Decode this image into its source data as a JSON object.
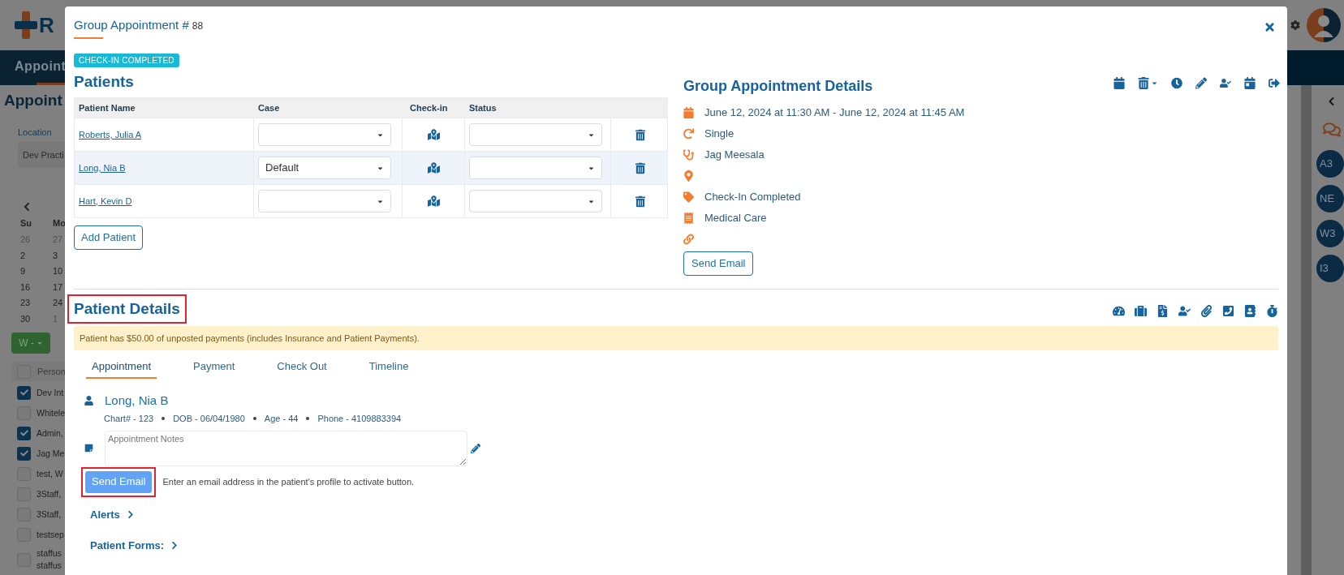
{
  "background": {
    "logo_text": "R",
    "nav_tab": "Appoint",
    "page_title": "Appoint",
    "location": {
      "label": "Location",
      "value": "Dev Practi"
    },
    "calendar": {
      "weekdays": [
        "Su",
        "Mo"
      ],
      "weeks": [
        [
          {
            "day": "26",
            "outside": true
          },
          {
            "day": "27",
            "outside": true
          }
        ],
        [
          {
            "day": "2",
            "outside": false
          },
          {
            "day": "3",
            "outside": false
          }
        ],
        [
          {
            "day": "9",
            "outside": false
          },
          {
            "day": "10",
            "outside": false
          }
        ],
        [
          {
            "day": "16",
            "outside": false
          },
          {
            "day": "17",
            "outside": false
          }
        ],
        [
          {
            "day": "23",
            "outside": false
          },
          {
            "day": "24",
            "outside": false
          }
        ],
        [
          {
            "day": "30",
            "outside": false
          },
          {
            "day": "1",
            "outside": true
          }
        ]
      ]
    },
    "view_button": "W -",
    "people": {
      "header": "Person",
      "header_checked": false,
      "items": [
        {
          "label": "Dev Int",
          "checked": true
        },
        {
          "label": "Whitele",
          "checked": false
        },
        {
          "label": "Admin,",
          "checked": true
        },
        {
          "label": "Jag Me",
          "checked": true
        },
        {
          "label": "test, W",
          "checked": false
        },
        {
          "label": "3Staff,",
          "checked": false
        },
        {
          "label": "3Staff,",
          "checked": false
        },
        {
          "label": "testsep",
          "checked": false
        },
        {
          "label": "staffus staffus",
          "checked": false
        }
      ]
    },
    "right_rail": {
      "avatars": [
        "A3",
        "NE",
        "W3",
        "I3"
      ]
    }
  },
  "modal": {
    "title": "Group Appointment #",
    "number": "88",
    "status_badge": "CHECK-IN COMPLETED",
    "patients": {
      "heading": "Patients",
      "columns": [
        "Patient Name",
        "Case",
        "Check-in",
        "Status"
      ],
      "rows": [
        {
          "name": "Roberts, Julia A",
          "selected": false
        },
        {
          "name": "Long, Nia B",
          "case": "Default",
          "selected": true
        },
        {
          "name": "Hart, Kevin D",
          "selected": false
        }
      ],
      "add_button": "Add Patient"
    },
    "details": {
      "heading": "Group Appointment Details",
      "items": [
        {
          "kind": "date",
          "text": "June 12, 2024 at 11:30 AM - June 12, 2024 at 11:45 AM"
        },
        {
          "kind": "recurrence",
          "text": "Single"
        },
        {
          "kind": "provider",
          "text": "Jag Meesala"
        },
        {
          "kind": "location"
        },
        {
          "kind": "status",
          "text": "Check-In Completed"
        },
        {
          "kind": "type",
          "text": "Medical Care"
        },
        {
          "kind": "link"
        }
      ],
      "send_button": "Send Email"
    },
    "patient_details": {
      "heading": "Patient Details",
      "heading_highlighted": true,
      "alert": "Patient has $50.00 of unposted payments (includes Insurance and Patient Payments).",
      "tabs": [
        {
          "label": "Appointment",
          "selected": true
        },
        {
          "label": "Payment",
          "selected": false
        },
        {
          "label": "Check Out",
          "selected": false
        },
        {
          "label": "Timeline",
          "selected": false
        }
      ],
      "patient": {
        "name": "Long, Nia B",
        "facts": [
          "Chart# - 123",
          "DOB - 06/04/1980",
          "Age - 44",
          "Phone - 4109883394"
        ]
      },
      "notes": {
        "placeholder": "Appointment Notes"
      },
      "send_email": {
        "label": "Send Email",
        "disabled": true,
        "highlighted": true
      },
      "hint": "Enter an email address in the patient's profile to activate button.",
      "sections": [
        "Alerts",
        "Patient Forms:"
      ]
    }
  }
}
